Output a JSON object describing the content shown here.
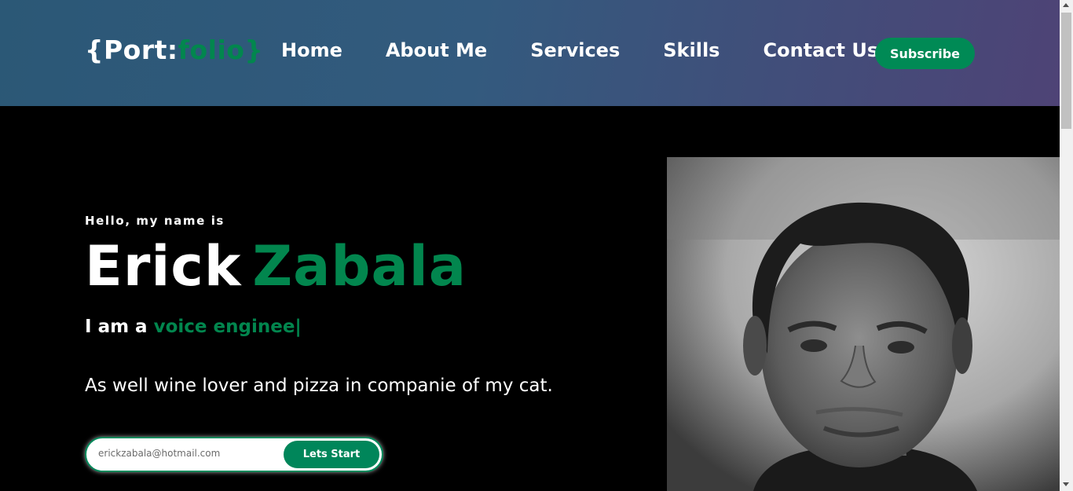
{
  "header": {
    "logo": {
      "open": "{Port:",
      "accent": "folio}"
    },
    "nav": [
      "Home",
      "About Me",
      "Services",
      "Skills",
      "Contact Us"
    ],
    "subscribe_label": "Subscribe"
  },
  "hero": {
    "greeting": "Hello, my name is",
    "first_name": "Erick",
    "last_name": "Zabala",
    "role_prefix": "I am a",
    "role_typed": "voice enginee|",
    "description": "As well wine lover and pizza in companie of my cat.",
    "email_value": "erickzabala@hotmail.com",
    "start_label": "Lets Start"
  },
  "colors": {
    "accent": "#02864e",
    "header_start": "#2b5876",
    "header_end": "#4e4376",
    "background": "#000000"
  },
  "icons": {
    "scroll_up": "arrow-up-icon",
    "scroll_down": "arrow-down-icon"
  }
}
